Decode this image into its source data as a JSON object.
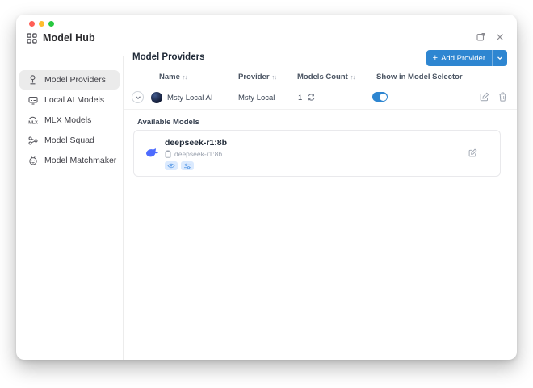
{
  "window": {
    "title": "Model Hub"
  },
  "sidebar": {
    "items": [
      {
        "label": "Model Providers",
        "icon": "provider-plug-icon",
        "active": true
      },
      {
        "label": "Local AI Models",
        "icon": "monitor-icon",
        "active": false
      },
      {
        "label": "MLX Models",
        "icon": "mlx-icon",
        "active": false
      },
      {
        "label": "Model Squad",
        "icon": "nodes-icon",
        "active": false
      },
      {
        "label": "Model Matchmaker",
        "icon": "matchmaker-icon",
        "active": false
      }
    ]
  },
  "main": {
    "heading": "Model Providers",
    "add_provider": {
      "plus": "+",
      "label": "Add Provider"
    },
    "table": {
      "sort_glyph": "↑↓",
      "columns": [
        "Name",
        "Provider",
        "Models Count",
        "Show in Model Selector"
      ],
      "row": {
        "name": "Msty Local AI",
        "provider": "Msty Local",
        "count": "1",
        "show_in_model_selector": true
      }
    },
    "available": {
      "heading": "Available Models",
      "model": {
        "title": "deepseek-r1:8b",
        "subtitle": "deepseek-r1:8b",
        "badges": [
          "vision-badge",
          "params-badge"
        ]
      }
    }
  },
  "colors": {
    "accent": "#2e86d1",
    "toggle_on": "#2e86d1",
    "deepseek_blue": "#4d6bfe",
    "badge_bg": "#dbeafe",
    "active_item_bg": "#ebebeb",
    "traffic_red": "#ff5f57",
    "traffic_yellow": "#febc2e",
    "traffic_green": "#28c840"
  }
}
